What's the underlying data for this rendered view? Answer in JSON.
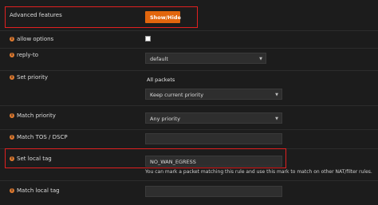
{
  "advanced": {
    "label": "Advanced features",
    "button": "Show/Hide"
  },
  "allow_options": {
    "label": "allow options",
    "checked": false
  },
  "reply_to": {
    "label": "reply-to",
    "value": "default"
  },
  "set_priority": {
    "label": "Set priority",
    "header": "All packets",
    "value": "Keep current priority"
  },
  "match_priority": {
    "label": "Match priority",
    "value": "Any priority"
  },
  "match_tos": {
    "label": "Match TOS / DSCP",
    "value": ""
  },
  "set_local_tag": {
    "label": "Set local tag",
    "value": "NO_WAN_EGRESS",
    "help": "You can mark a packet matching this rule and use this mark to match on other NAT/filter rules."
  },
  "match_local_tag": {
    "label": "Match local tag",
    "value": ""
  },
  "icons": {
    "info": "info-circle-icon",
    "caret": "chevron-down-icon"
  },
  "colors": {
    "accent": "#e2660d",
    "highlight": "#e02020",
    "info": "#e07a2f"
  }
}
